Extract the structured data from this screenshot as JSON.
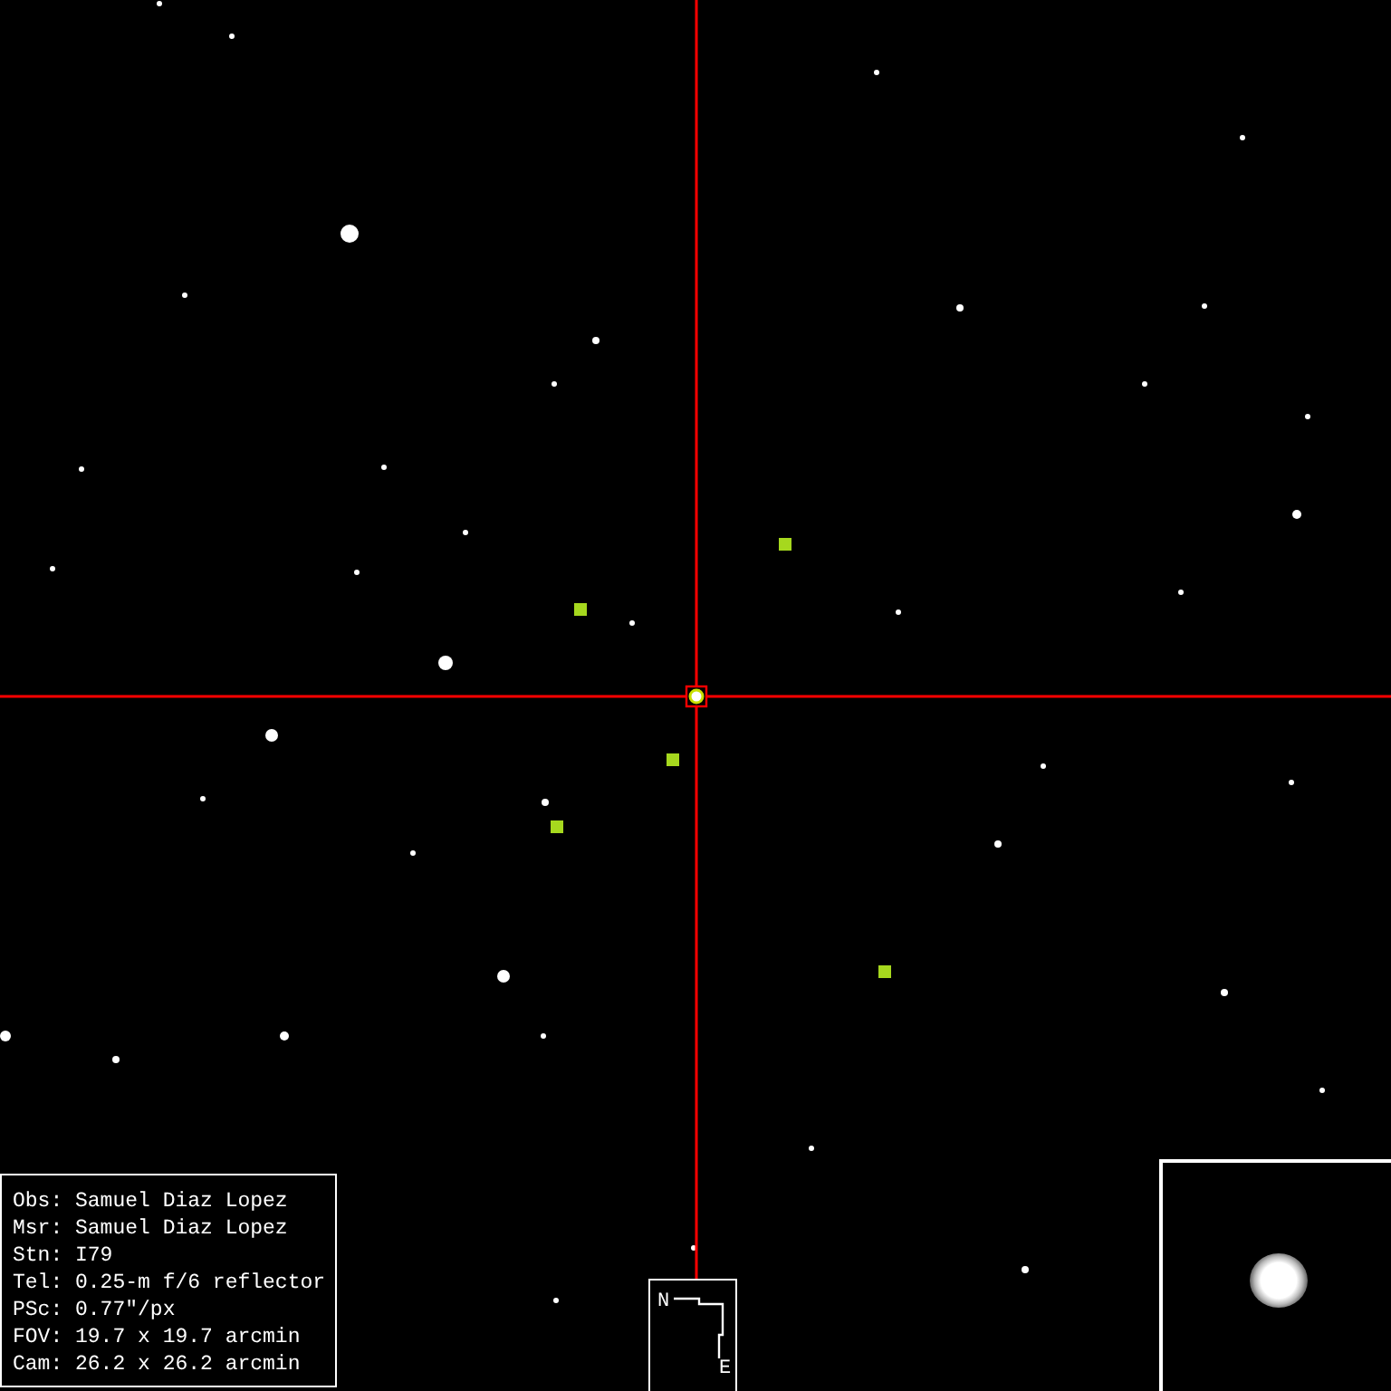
{
  "info_box": {
    "lines": [
      "Obs: Samuel Diaz Lopez",
      "Msr: Samuel Diaz Lopez",
      "Stn: I79",
      "Tel: 0.25-m f/6 reflector",
      "PSc: 0.77\"/px",
      "FOV: 19.7 x 19.7 arcmin",
      "Cam: 26.2 x 26.2 arcmin"
    ]
  },
  "compass": {
    "north": "N",
    "east": "E"
  }
}
